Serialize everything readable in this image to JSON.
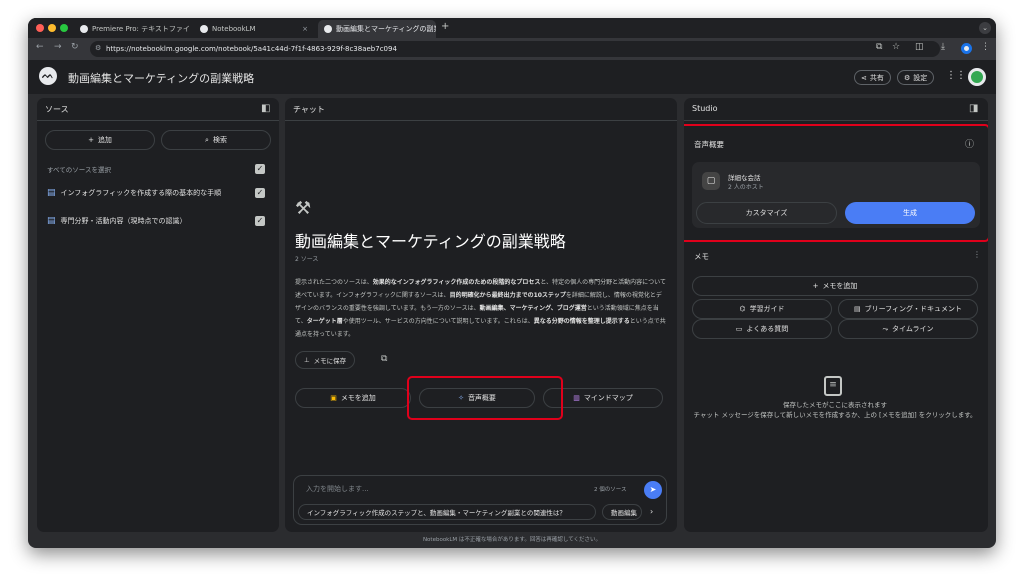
{
  "browser": {
    "tabs": [
      {
        "title": "Premiere Pro: テキストファイル",
        "close": "×"
      },
      {
        "title": "NotebookLM",
        "close": "×"
      },
      {
        "title": "動画編集とマーケティングの副業",
        "close": "×"
      }
    ],
    "new_tab": "+",
    "url": "https://notebooklm.google.com/notebook/5a41c44d-7f1f-4863-929f-8c38aeb7c094",
    "colors": {
      "red": "#ff5f57",
      "yellow": "#febc2e",
      "green": "#28c840"
    }
  },
  "header": {
    "title": "動画編集とマーケティングの副業戦略",
    "share": "共有",
    "settings": "設定"
  },
  "sources": {
    "title": "ソース",
    "add": "追加",
    "search": "検索",
    "select_all": "すべてのソースを選択",
    "items": [
      {
        "label": "インフォグラフィックを作成する際の基本的な手順"
      },
      {
        "label": "専門分野・活動内容（現時点での認識）"
      }
    ]
  },
  "chat": {
    "title": "チャット",
    "notebook_title": "動画編集とマーケティングの副業戦略",
    "source_count": "2 ソース",
    "summary_parts": [
      {
        "text": "提示された二つのソースは、",
        "bold": false
      },
      {
        "text": "効果的なインフォグラフィック作成のための段階的なプロセス",
        "bold": true
      },
      {
        "text": "と、特定の個人の専門分野と活動内容について述べています。インフォグラフィックに関するソースは、",
        "bold": false
      },
      {
        "text": "目的明確化から最終出力までの10ステップ",
        "bold": true
      },
      {
        "text": "を詳細に解説し、情報の視覚化とデザインのバランスの重要性を強調しています。もう一方のソースは、",
        "bold": false
      },
      {
        "text": "動画編集、マーケティング、ブログ運営",
        "bold": true
      },
      {
        "text": "という活動領域に焦点を当て、",
        "bold": false
      },
      {
        "text": "ターゲット層",
        "bold": true
      },
      {
        "text": "や使用ツール、サービスの方向性について説明しています。これらは、",
        "bold": false
      },
      {
        "text": "異なる分野の情報を整理し提示する",
        "bold": true
      },
      {
        "text": "という点で共通点を持っています。",
        "bold": false
      }
    ],
    "save_memo": "メモに保存",
    "actions": {
      "add_memo": "メモを追加",
      "audio_overview": "音声概要",
      "mind_map": "マインドマップ"
    },
    "input_placeholder": "入力を開始します...",
    "input_source_count": "2 個のソース",
    "suggestions": [
      "インフォグラフィック作成のステップと、動画編集・マーケティング副業との関連性は？",
      "動画編集"
    ]
  },
  "studio": {
    "title": "Studio",
    "audio_title": "音声概要",
    "deep_dive": "詳細な会話",
    "hosts": "2 人のホスト",
    "customize": "カスタマイズ",
    "generate": "生成",
    "memo_title": "メモ",
    "add_memo": "メモを追加",
    "study_guide": "学習ガイド",
    "briefing": "ブリーフィング・ドキュメント",
    "faq": "よくある質問",
    "timeline": "タイムライン",
    "empty_title": "保存したメモがここに表示されます",
    "empty_desc": "チャット メッセージを保存して新しいメモを作成するか、上の [メモを追加] をクリックします。"
  },
  "footer": "NotebookLM は不正確な場合があります。回答は再確認してください。"
}
